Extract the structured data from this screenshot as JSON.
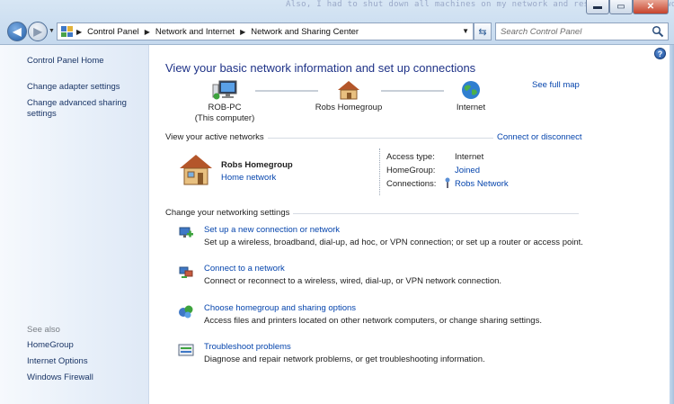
{
  "background_text": "Also, I had to shut down all machines on my network and restart to get it working",
  "window_controls": {
    "minimize": "▬",
    "maximize": "▭",
    "close": "✕"
  },
  "address": {
    "crumbs": [
      "Control Panel",
      "Network and Internet",
      "Network and Sharing Center"
    ]
  },
  "search": {
    "placeholder": "Search Control Panel"
  },
  "sidebar": {
    "items": [
      {
        "label": "Control Panel Home"
      },
      {
        "label": "Change adapter settings"
      },
      {
        "label": "Change advanced sharing settings"
      }
    ],
    "see_also_label": "See also",
    "see_also": [
      {
        "label": "HomeGroup"
      },
      {
        "label": "Internet Options"
      },
      {
        "label": "Windows Firewall"
      }
    ]
  },
  "main": {
    "title": "View your basic network information and set up connections",
    "see_full_map": "See full map",
    "map": {
      "computer": {
        "name": "ROB-PC",
        "sub": "(This computer)"
      },
      "homegroup": {
        "name": "Robs Homegroup"
      },
      "internet": {
        "name": "Internet"
      }
    },
    "active_networks": {
      "title": "View your active networks",
      "connect_link": "Connect or disconnect",
      "network_name": "Robs Homegroup",
      "network_type": "Home network",
      "props": [
        {
          "label": "Access type:",
          "value": "Internet"
        },
        {
          "label": "HomeGroup:",
          "value": "Joined"
        },
        {
          "label": "Connections:",
          "value": "Robs Network"
        }
      ]
    },
    "settings": {
      "title": "Change your networking settings",
      "tasks": [
        {
          "link": "Set up a new connection or network",
          "desc": "Set up a wireless, broadband, dial-up, ad hoc, or VPN connection; or set up a router or access point."
        },
        {
          "link": "Connect to a network",
          "desc": "Connect or reconnect to a wireless, wired, dial-up, or VPN network connection."
        },
        {
          "link": "Choose homegroup and sharing options",
          "desc": "Access files and printers located on other network computers, or change sharing settings."
        },
        {
          "link": "Troubleshoot problems",
          "desc": "Diagnose and repair network problems, or get troubleshooting information."
        }
      ]
    }
  }
}
